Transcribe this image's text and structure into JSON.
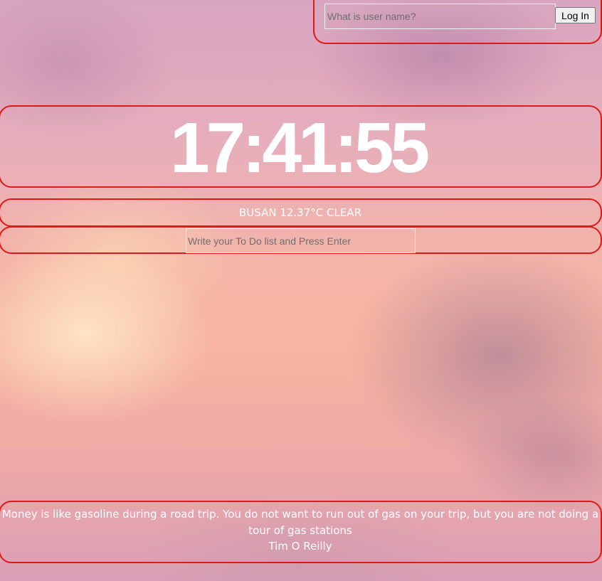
{
  "login": {
    "input_placeholder": "What is user name?",
    "input_value": "",
    "button_label": "Log In"
  },
  "clock": {
    "time": "17:41:55"
  },
  "weather": {
    "text": "BUSAN 12.37°C CLEAR"
  },
  "todo": {
    "input_placeholder": "Write your To Do list and Press Enter",
    "input_value": ""
  },
  "quote": {
    "text": "Money is like gasoline during a road trip. You do not want to run out of gas on your trip, but you are not doing a tour of gas stations",
    "author": "Tim O Reilly"
  },
  "colors": {
    "outline": "#e01818",
    "text": "#ffffff"
  }
}
